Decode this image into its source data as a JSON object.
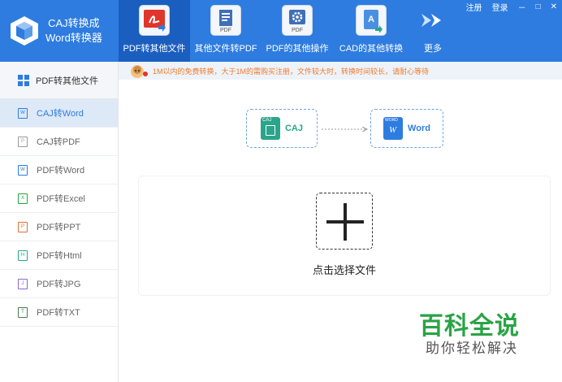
{
  "app": {
    "logo_line1": "CAJ转换成",
    "logo_line2": "Word转换器"
  },
  "window_controls": {
    "register": "注册",
    "login": "登录",
    "minimize": "－",
    "maximize": "□",
    "close": "✕"
  },
  "tools": [
    {
      "label": "PDF转其他文件",
      "icon": "pdf-acrobat-icon",
      "active": true
    },
    {
      "label": "其他文件转PDF",
      "icon": "document-to-pdf-icon"
    },
    {
      "label": "PDF的其他操作",
      "icon": "pdf-gear-icon"
    },
    {
      "label": "CAD的其他转换",
      "icon": "cad-file-icon"
    },
    {
      "label": "更多",
      "icon": "double-arrow-icon"
    }
  ],
  "sidebar": {
    "header": "PDF转其他文件",
    "items": [
      {
        "label": "CAJ转Word",
        "icon": "caj-word-icon",
        "active": true
      },
      {
        "label": "CAJ转PDF",
        "icon": "caj-pdf-icon"
      },
      {
        "label": "PDF转Word",
        "icon": "word-file-icon"
      },
      {
        "label": "PDF转Excel",
        "icon": "excel-file-icon"
      },
      {
        "label": "PDF转PPT",
        "icon": "ppt-file-icon"
      },
      {
        "label": "PDF转Html",
        "icon": "html-file-icon"
      },
      {
        "label": "PDF转JPG",
        "icon": "jpg-file-icon"
      },
      {
        "label": "PDF转TXT",
        "icon": "txt-file-icon"
      }
    ]
  },
  "notice": "1M以内的免费转换，大于1M的需购买注册，文件较大时，转换时间较长，请耐心等待",
  "flow": {
    "source": "CAJ",
    "target": "Word",
    "source_badge": "CAJ",
    "target_badge": "WORD"
  },
  "drop": {
    "label": "点击选择文件"
  },
  "watermark": {
    "title": "百科全说",
    "subtitle": "助你轻松解决"
  },
  "colors": {
    "topbar": "#2e7ce0",
    "active_tool": "#1a5fc0",
    "caj_green": "#2aa58c",
    "word_blue": "#2e7ce0",
    "notice_orange": "#f07a2a"
  }
}
